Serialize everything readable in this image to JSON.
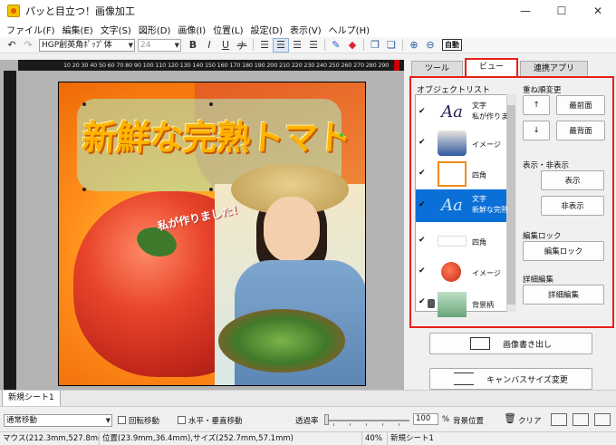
{
  "window": {
    "title": "パッと目立つ！画像加工",
    "minimize": "—",
    "maximize": "☐",
    "close": "✕"
  },
  "menu": [
    "ファイル(F)",
    "編集(E)",
    "文字(S)",
    "図形(D)",
    "画像(I)",
    "位置(L)",
    "設定(D)",
    "表示(V)",
    "ヘルプ(H)"
  ],
  "toolbar": {
    "font": "HGP創英角ﾎﾟｯﾌﾟ体",
    "size": "24",
    "bold": "B",
    "italic": "I",
    "underline": "U",
    "strike": "ナ",
    "auto": "自動"
  },
  "ruler": {
    "top_text": "10 20 30 40 50 60 70 80 90 100 110 120 130 140 150 160 170 180 190 200 210 220 230 240 250 260 270 280 290"
  },
  "canvas": {
    "headline": "新鮮な完熟トマト",
    "catch": "私が作りました！"
  },
  "tabs": [
    {
      "label": "ツール",
      "active": false
    },
    {
      "label": "ビュー",
      "active": true
    },
    {
      "label": "連携アプリ",
      "active": false
    }
  ],
  "panel": {
    "object_list_label": "オブジェクトリスト",
    "objects": [
      {
        "checked": true,
        "thumb": "text",
        "thumb_text": "Aa",
        "type": "文字",
        "sub": "私が作りま",
        "selected": false
      },
      {
        "checked": true,
        "thumb": "img1",
        "type": "イメージ",
        "sub": "",
        "selected": false
      },
      {
        "checked": true,
        "thumb": "rect",
        "type": "四角",
        "sub": "",
        "selected": false
      },
      {
        "checked": true,
        "thumb": "text",
        "thumb_text": "Aa",
        "type": "文字",
        "sub": "新鮮な完熟",
        "selected": true
      },
      {
        "checked": true,
        "thumb": "white",
        "type": "四角",
        "sub": "",
        "selected": false
      },
      {
        "checked": true,
        "thumb": "tomato-ic",
        "type": "イメージ",
        "sub": "",
        "selected": false
      },
      {
        "checked": true,
        "thumb": "bg",
        "type": "背景柄",
        "sub": "",
        "selected": false,
        "locked": true
      }
    ],
    "order_label": "重ね順変更",
    "up": "↑",
    "front": "最前面",
    "down": "↓",
    "back": "最背面",
    "visibility_label": "表示・非表示",
    "show": "表示",
    "hide": "非表示",
    "lock_label": "編集ロック",
    "lock_btn": "編集ロック",
    "detail_label": "詳細編集",
    "detail_btn": "詳細編集"
  },
  "actions": {
    "export": "画像書き出し",
    "canvas_size": "キャンバスサイズ変更"
  },
  "sheet_tab": "新規シート1",
  "bottom": {
    "mode": "通常移動",
    "rotate": "回転移動",
    "align": "水平・垂直移動",
    "opacity_label": "透過率",
    "opacity_value": "100",
    "pct": "%",
    "bg_position": "背景位置",
    "clear": "クリア"
  },
  "status": {
    "mouse": "マウス(212.3mm,527.8mm)",
    "pos": "位置(23.9mm,36.4mm),サイズ(252.7mm,57.1mm)",
    "zoom": "40%",
    "sheet": "新規シート1"
  }
}
